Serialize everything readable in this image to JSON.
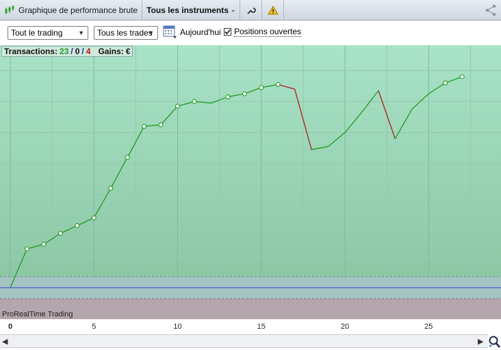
{
  "titlebar": {
    "title": "Graphique de performance brute",
    "instruments": "Tous les instruments",
    "instruments_chevron": "⌄",
    "icons": [
      "candlestick-icon",
      "wrench-icon",
      "warning-icon",
      "share-icon"
    ]
  },
  "toolbar": {
    "scope_select": "Tout le trading",
    "trades_select": "Tous les trades",
    "today_label": "Aujourd'hui",
    "open_positions_label": "Positions ouvertes",
    "open_positions_checked": true
  },
  "stats": {
    "transactions_label": "Transactions:",
    "wins": "23",
    "sep1": "/",
    "neutral": "0",
    "sep2": "/",
    "losses": "4",
    "gains_label": "Gains:",
    "gains_value": "€"
  },
  "watermark": "ProRealTime Trading",
  "colors": {
    "up": "#1f9a1f",
    "down": "#b01818",
    "baseline": "#2a3fd0",
    "bg_top": "#a9e3c8",
    "bg_bottom": "#8cc7a5",
    "neutral_band": "#a4c3c3",
    "loss_band": "#b5a6ae"
  },
  "chart_data": {
    "type": "line",
    "x": [
      0,
      1,
      2,
      3,
      4,
      5,
      6,
      7,
      8,
      9,
      10,
      11,
      12,
      13,
      14,
      15,
      16,
      17,
      18,
      19,
      20,
      21,
      22,
      23,
      24,
      25,
      26,
      27
    ],
    "y": [
      0,
      25,
      28,
      35,
      40,
      45,
      64,
      84,
      104,
      105,
      117,
      120,
      119,
      123,
      125,
      129,
      131,
      128,
      89,
      91,
      100,
      113,
      127,
      96,
      115,
      125,
      132,
      136
    ],
    "down_segments": [
      [
        16,
        17
      ],
      [
        17,
        18
      ],
      [
        22,
        23
      ]
    ],
    "markers": [
      1,
      2,
      3,
      4,
      5,
      6,
      7,
      8,
      9,
      10,
      11,
      13,
      14,
      15,
      16,
      26,
      27
    ],
    "xlim": [
      0,
      29.5
    ],
    "ylim": [
      -20,
      155
    ],
    "xticks": [
      "0",
      "5",
      "10",
      "15",
      "20",
      "25"
    ],
    "xtick_values": [
      0,
      5,
      10,
      15,
      20,
      25
    ],
    "grid": true
  }
}
